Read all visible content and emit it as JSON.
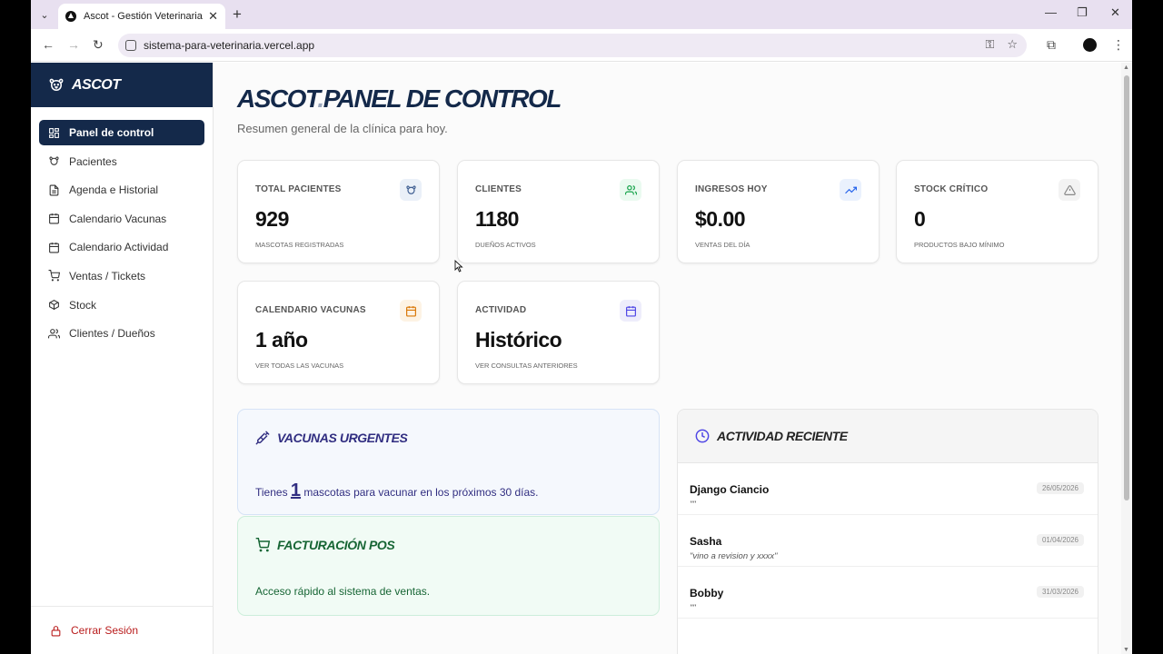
{
  "browser": {
    "tab_title": "Ascot - Gestión Veterinaria",
    "url": "sistema-para-veterinaria.vercel.app"
  },
  "sidebar": {
    "brand": "ASCOT",
    "items": [
      {
        "label": "Panel de control",
        "icon": "layout-grid-icon",
        "active": true
      },
      {
        "label": "Pacientes",
        "icon": "paw-icon"
      },
      {
        "label": "Agenda e Historial",
        "icon": "file-text-icon"
      },
      {
        "label": "Calendario Vacunas",
        "icon": "calendar-icon"
      },
      {
        "label": "Calendario Actividad",
        "icon": "calendar-icon"
      },
      {
        "label": "Ventas / Tickets",
        "icon": "shopping-cart-icon"
      },
      {
        "label": "Stock",
        "icon": "package-icon"
      },
      {
        "label": "Clientes / Dueños",
        "icon": "users-icon"
      }
    ],
    "logout": "Cerrar Sesión"
  },
  "header": {
    "title_brand": "ASCOT",
    "title_dot": ".",
    "title_rest": "PANEL DE CONTROL",
    "subtitle": "Resumen general de la clínica para hoy."
  },
  "cards": [
    {
      "label": "TOTAL PACIENTES",
      "value": "929",
      "note": "MASCOTAS REGISTRADAS",
      "icon": "paw-icon",
      "color": "#3b5b8f",
      "bg": "#eaf0f8"
    },
    {
      "label": "CLIENTES",
      "value": "1180",
      "note": "DUEÑOS ACTIVOS",
      "icon": "users-icon",
      "color": "#16a34a",
      "bg": "#eafaf0"
    },
    {
      "label": "INGRESOS HOY",
      "value": "$0.00",
      "note": "VENTAS DEL DÍA",
      "icon": "trending-up-icon",
      "color": "#2563eb",
      "bg": "#eaf1fd"
    },
    {
      "label": "STOCK CRÍTICO",
      "value": "0",
      "note": "PRODUCTOS BAJO MÍNIMO",
      "icon": "alert-triangle-icon",
      "color": "#888888",
      "bg": "#f3f3f3"
    },
    {
      "label": "CALENDARIO VACUNAS",
      "value": "1 año",
      "note": "VER TODAS LAS VACUNAS",
      "icon": "calendar-icon",
      "color": "#d97706",
      "bg": "#fdf3e4"
    },
    {
      "label": "ACTIVIDAD",
      "value": "Histórico",
      "note": "VER CONSULTAS ANTERIORES",
      "icon": "calendar-icon",
      "color": "#4f46e5",
      "bg": "#eeedfb"
    }
  ],
  "vacunas_urgentes": {
    "title": "VACUNAS URGENTES",
    "text_before": "Tienes",
    "count": "1",
    "text_after": "mascotas para vacunar en los próximos 30 días.",
    "color": "#312e81"
  },
  "facturacion": {
    "title": "FACTURACIÓN POS",
    "text": "Acceso rápido al sistema de ventas.",
    "color": "#166534"
  },
  "actividad": {
    "title": "ACTIVIDAD RECIENTE",
    "rows": [
      {
        "name": "Django Ciancio",
        "date": "26/05/2026",
        "note": "\"\""
      },
      {
        "name": "Sasha",
        "date": "01/04/2026",
        "note": "\"vino a revision y xxxx\""
      },
      {
        "name": "Bobby",
        "date": "31/03/2026",
        "note": "\"\""
      }
    ]
  }
}
